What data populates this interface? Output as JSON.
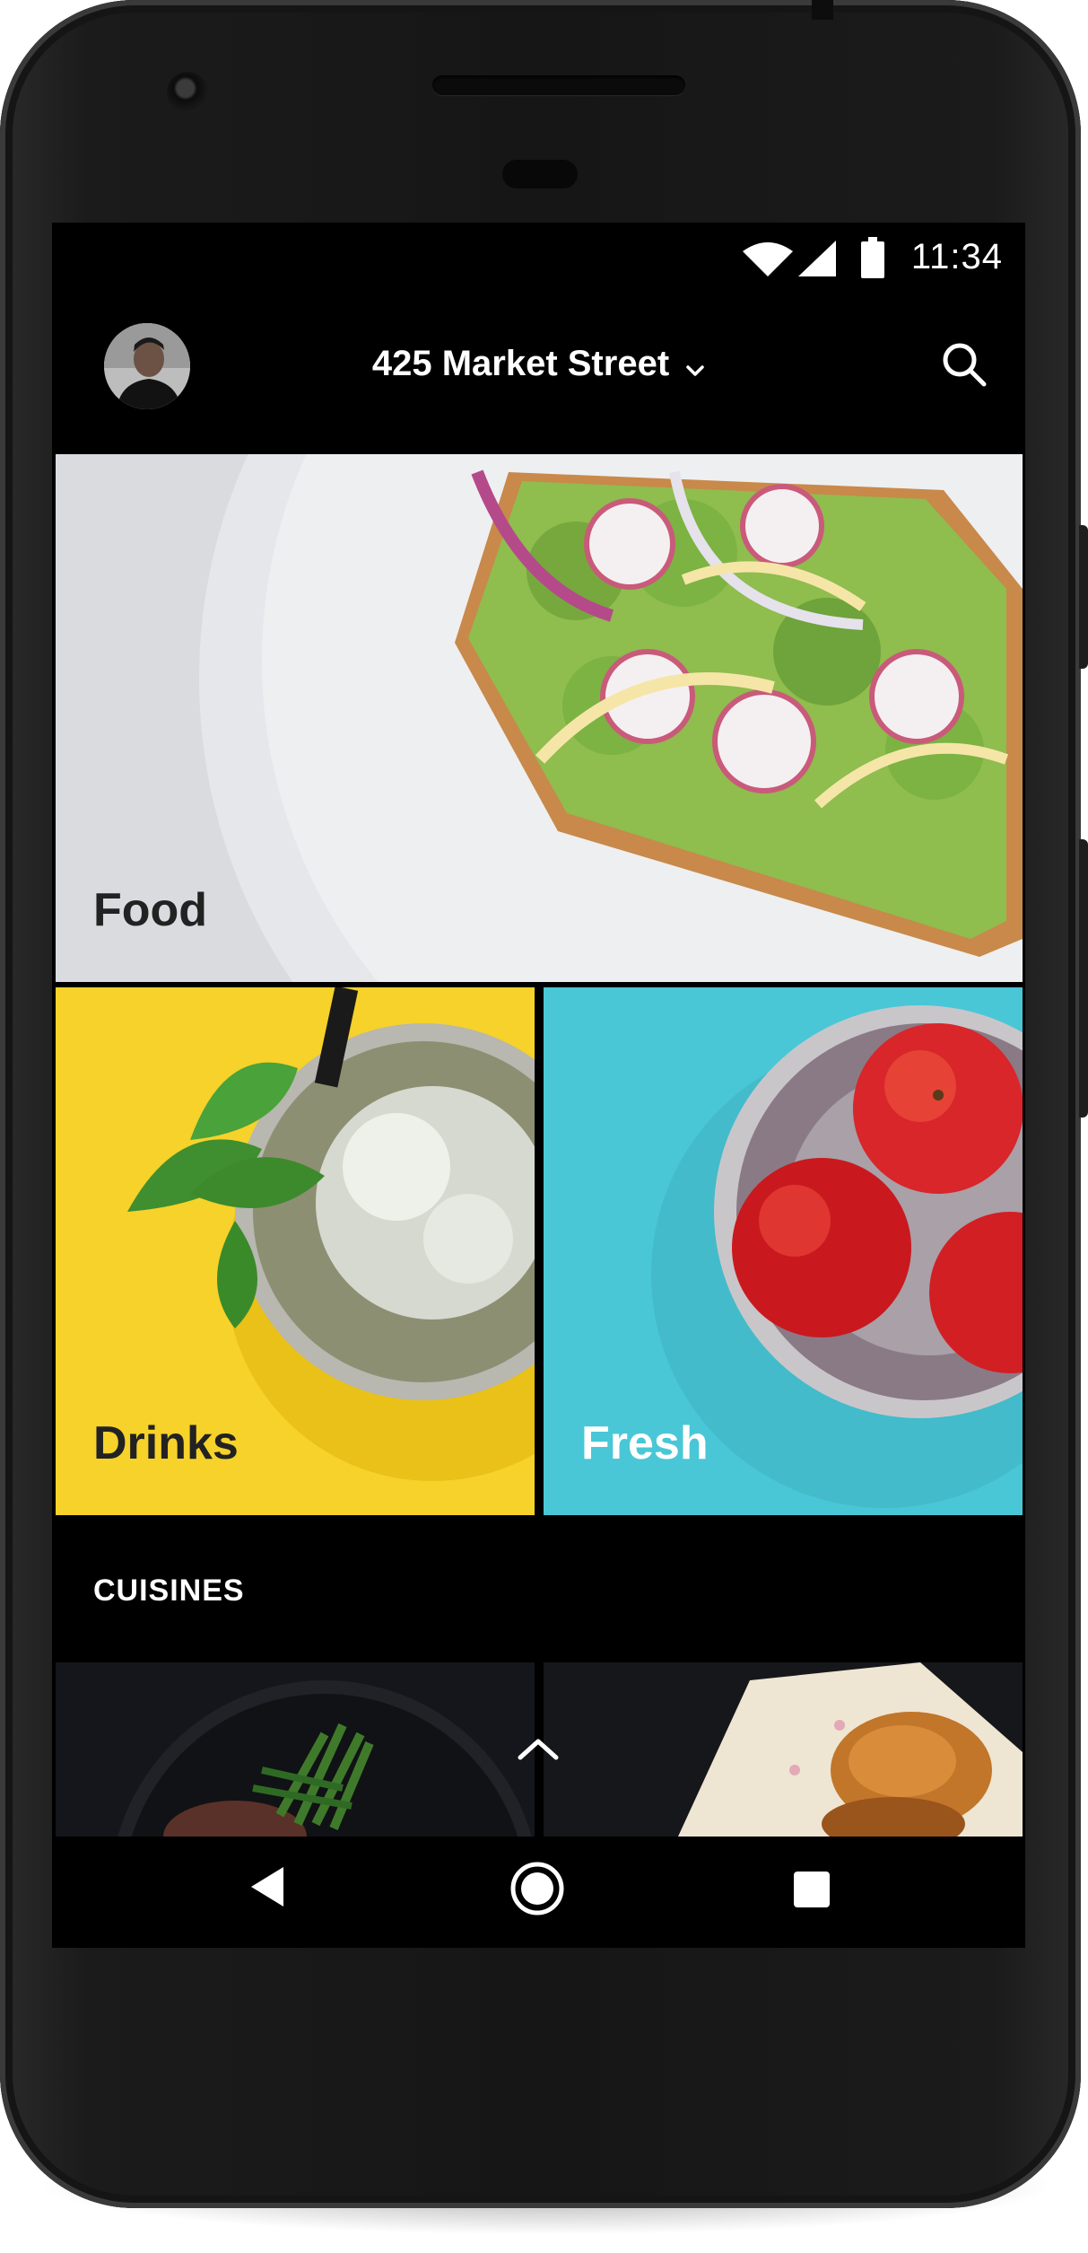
{
  "status_bar": {
    "time": "11:34",
    "icons": [
      "wifi-icon",
      "cell-signal-icon",
      "battery-icon"
    ]
  },
  "header": {
    "address": "425 Market Street",
    "dropdown_icon": "chevron-down-icon",
    "search_icon": "search-icon",
    "avatar": "profile-avatar"
  },
  "categories": [
    {
      "label": "Food",
      "color": "#d6d8dc",
      "label_color": "#222222"
    },
    {
      "label": "Drinks",
      "color": "#f6d22a",
      "label_color": "#222222"
    },
    {
      "label": "Fresh",
      "color": "#49c7d6",
      "label_color": "#ffffff"
    }
  ],
  "section": {
    "title": "CUISINES"
  },
  "collapse_icon": "chevron-up-icon",
  "nav_bar": {
    "icons": [
      "back-icon",
      "home-icon",
      "recents-icon"
    ]
  }
}
